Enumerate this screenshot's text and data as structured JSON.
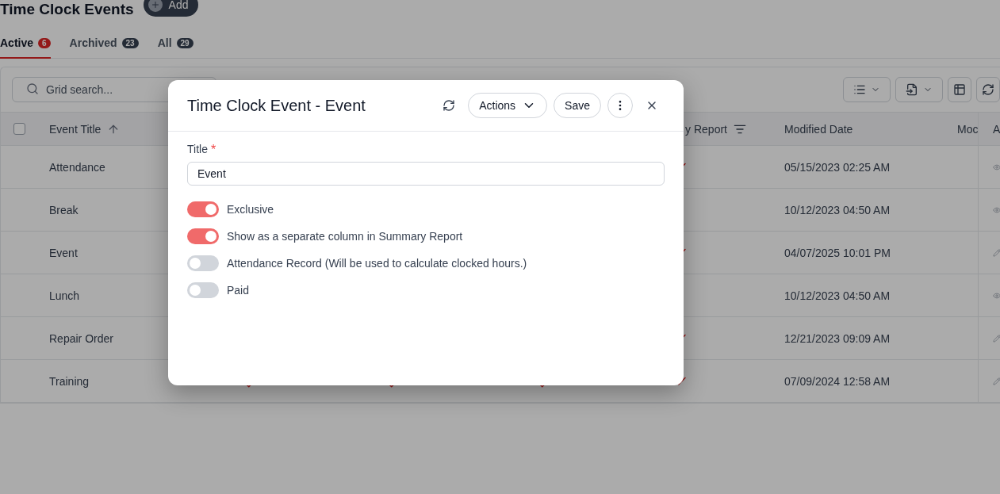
{
  "page": {
    "title": "Time Clock Events",
    "add_button": "Add"
  },
  "tabs": [
    {
      "label": "Active",
      "count": "6",
      "selected": true
    },
    {
      "label": "Archived",
      "count": "23",
      "selected": false
    },
    {
      "label": "All",
      "count": "29",
      "selected": false
    }
  ],
  "search": {
    "placeholder": "Grid search..."
  },
  "table": {
    "select_all_checked": false,
    "columns": [
      {
        "label": "Event Title",
        "sorted": true
      },
      {
        "label": "y Report",
        "filter": true
      },
      {
        "label": "Modified Date"
      },
      {
        "label": "Moc"
      },
      {
        "label": "A"
      }
    ],
    "rows": [
      {
        "title": "Attendance",
        "report": true,
        "modified": "05/15/2023 02:25 AM",
        "kind": "view"
      },
      {
        "title": "Break",
        "report": false,
        "modified": "10/12/2023 04:50 AM",
        "kind": "view"
      },
      {
        "title": "Event",
        "report": true,
        "modified": "04/07/2025 10:01 PM",
        "kind": "edit"
      },
      {
        "title": "Lunch",
        "report": false,
        "modified": "10/12/2023 04:50 AM",
        "kind": "view"
      },
      {
        "title": "Repair Order",
        "report": true,
        "modified": "12/21/2023 09:09 AM",
        "kind": "edit"
      },
      {
        "title": "Training",
        "report": true,
        "modified": "07/09/2024 12:58 AM",
        "kind": "edit",
        "column_checks": [
          true,
          true,
          true
        ]
      }
    ]
  },
  "modal": {
    "title": "Time Clock Event - Event",
    "actions_button": "Actions",
    "save_button": "Save",
    "field": {
      "label": "Title",
      "required_mark": "*",
      "value": "Event"
    },
    "toggles": [
      {
        "label": "Exclusive",
        "on": true
      },
      {
        "label": "Show as a separate column in Summary Report",
        "on": true
      },
      {
        "label": "Attendance Record (Will be used to calculate clocked hours.)",
        "on": false
      },
      {
        "label": "Paid",
        "on": false
      }
    ]
  }
}
